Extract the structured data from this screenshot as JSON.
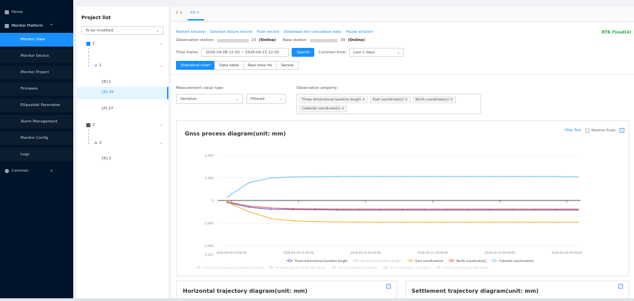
{
  "sidebar": {
    "items": [
      {
        "label": "Home",
        "icon": "home-icon"
      },
      {
        "label": "Monitor Platform",
        "icon": "monitor-icon",
        "caret": "^"
      },
      {
        "label": "Monitor View"
      },
      {
        "label": "Monitor Device"
      },
      {
        "label": "Monitor Project"
      },
      {
        "label": "Firmware"
      },
      {
        "label": "Ellipsoidal Parameter"
      },
      {
        "label": "Alarm Management"
      },
      {
        "label": "Monitor Config"
      },
      {
        "label": "Logs"
      },
      {
        "label": "Common",
        "icon": "gear-icon",
        "caret": "v"
      }
    ]
  },
  "project": {
    "title": "Project list",
    "filter_value": "To be modified",
    "tree": {
      "n1": "1",
      "n1_child": "1",
      "n1_leaf1": "[R] 1",
      "n1_leaf2": "[B] 33",
      "n1_leaf3": "[P] 27",
      "n2": "2",
      "n2_child": "2",
      "n2_leaf1": "[R] 2"
    }
  },
  "tabs": [
    "1",
    "03"
  ],
  "toolbar": {
    "links": [
      "Restart solution",
      "Solution failure record",
      "Push record",
      "Download the calculation data",
      "Pause solution"
    ],
    "rtk": "RTK Fixed(4)"
  },
  "obs": {
    "station_label": "Observation station:",
    "station_suffix": "23",
    "station_status": "(Online)",
    "base_label": "Base station:",
    "base_suffix": "39",
    "base_status": "(Online)"
  },
  "time": {
    "label": "Time frame:",
    "range": "2026-04-08 12:00  ~  2026-04-15 12:00",
    "search": "Search",
    "common_label": "Common time:",
    "common_value": "Last 1 days"
  },
  "subtabs": [
    "Statistical chart",
    "Data table",
    "Real time rtk",
    "Sensor"
  ],
  "filters": {
    "mtype_label": "Measurement value type:",
    "mtype_value": "Variation",
    "filter_value": "Filtered",
    "prop_label": "Observation property:",
    "tags": [
      "Three-dimensional baseline length",
      "East coordinate(z)",
      "North coordinate(y)",
      "Celestial coordinate(z)"
    ]
  },
  "chart_panel": {
    "title": "Gnss process diagram(unit: mm)",
    "filter_test": "Filter Test",
    "reserve_scale": "Reserve Scale"
  },
  "chart_data": {
    "type": "line",
    "yticks": [
      "2,000",
      "1,000",
      "0",
      "-1,000",
      "-2,000",
      "-2,237"
    ],
    "ylim": [
      -2237,
      2000
    ],
    "xticks": [
      "2026-04-09 19:00:00",
      "2026-04-10 01:00:00",
      "2026-04-10 16:00:00",
      "2026-04-11 10:00:00",
      "2026-04-13 09:00:00",
      "2026-04-14 09:00:00"
    ],
    "series": [
      {
        "name": "Three-dimensional baseline length",
        "color": "#5b5bd6",
        "values": [
          -100,
          -300,
          -390,
          -400,
          -410,
          -420,
          -420,
          -420,
          -420,
          -420,
          -420,
          -420,
          -420,
          -420,
          -420,
          -420,
          -420
        ]
      },
      {
        "name": "Horizontal baseline length",
        "color": "#c8c8c8",
        "values": []
      },
      {
        "name": "East coordinate(z)",
        "color": "#f5b33a",
        "values": [
          -80,
          -500,
          -800,
          -900,
          -930,
          -950,
          -960,
          -960,
          -960,
          -960,
          -960,
          -960,
          -960,
          -960,
          -960,
          -960,
          -960
        ]
      },
      {
        "name": "North coordinate(y)",
        "color": "#e8524a",
        "values": [
          -60,
          -250,
          -330,
          -360,
          -370,
          -380,
          -385,
          -385,
          -385,
          -385,
          -385,
          -385,
          -385,
          -385,
          -385,
          -385,
          -385
        ]
      },
      {
        "name": "Celestial coordinate(z)",
        "color": "#6ec3f0",
        "values": [
          150,
          800,
          1000,
          1040,
          1050,
          1060,
          1060,
          1060,
          1060,
          1060,
          1060,
          1060,
          1060,
          1060,
          1060,
          1060,
          1040
        ]
      }
    ],
    "legend_row2": [
      "Three-dimensional baseline length Not Filtered",
      "Horizontal baseline length Not Filtered",
      "East coordinate(z) Not Filtered",
      "North coordinate(y) Not Filtered",
      "Celestial coordinate(z) Not Filtered"
    ]
  },
  "bottom_panels": {
    "horizontal": "Horizontal trajectory diagram(unit: mm)",
    "settlement": "Settlement trajectory diagram(unit: mm)"
  }
}
